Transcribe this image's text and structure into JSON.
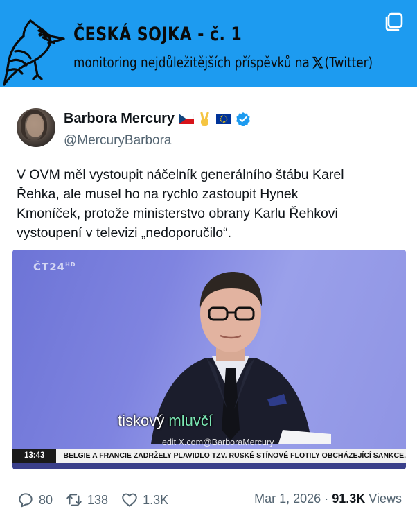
{
  "banner": {
    "title": "ČESKÁ SOJKA - č. 1",
    "subtitle_before": "monitoring nejdůležitějších příspěvků na",
    "subtitle_after": "(Twitter)",
    "background_color": "#1d9bf0"
  },
  "profile": {
    "display_name": "Barbora Mercury",
    "handle": "@MercuryBarbora",
    "verified": true,
    "name_emojis": [
      "czech-flag",
      "victory-hand",
      "eu-flag"
    ]
  },
  "tweet": {
    "lines": [
      "V OVM měl vystoupit náčelník generálního štábu Karel",
      "Řehka, ale musel ho na rychlo zastoupit Hynek",
      "Kmoníček, protože ministerstvo obrany Karlu Řehkovi",
      "vystoupení v televizi „nedoporučilo“."
    ]
  },
  "media": {
    "channel_logo": "ČT24",
    "channel_logo_suffix": "HD",
    "subtitle_white": "tiskový",
    "subtitle_green": "mluvčí",
    "watermark": "edit X.com@BarboraMercury",
    "ticker_time": "13:43",
    "ticker_text": "BELGIE A FRANCIE ZADRŽELY PLAVIDLO TZV. RUSKÉ STÍNOVÉ FLOTILY OBCHÁZEJÍCÍ SANKCE."
  },
  "footer": {
    "replies": "80",
    "reposts": "138",
    "likes": "1.3K",
    "date": "Mar 1, 2026",
    "separator": "·",
    "views_count": "91.3K",
    "views_label": "Views"
  }
}
